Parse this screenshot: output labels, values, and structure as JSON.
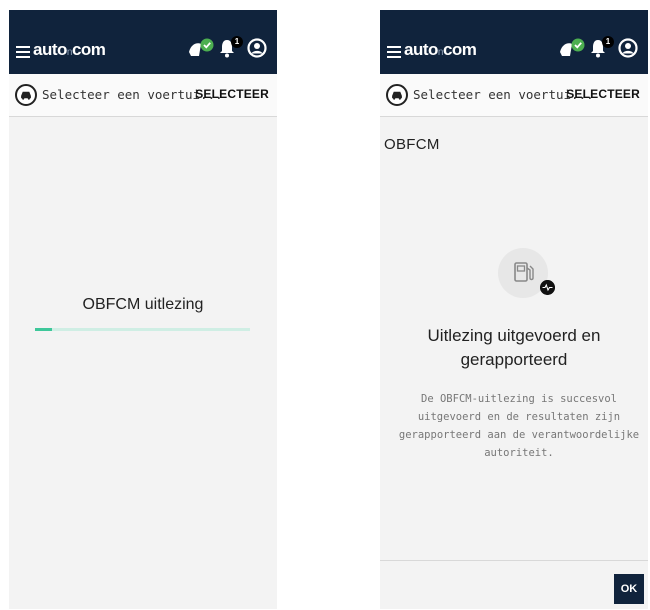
{
  "header": {
    "brand": {
      "left": "auto",
      "mid": "n",
      "right": "com"
    },
    "notification_count": "1"
  },
  "vehicle_bar": {
    "text": "Selecteer een voertui...",
    "select_label": "SELECTEER"
  },
  "left_screen": {
    "loading_title": "OBFCM uitlezing",
    "progress": 0.08
  },
  "right_screen": {
    "section_title": "OBFCM",
    "result_title_line1": "Uitlezing uitgevoerd en",
    "result_title_line2": "gerapporteerd",
    "description_lines": [
      "De OBFCM-uitlezing is succesvol",
      "uitgevoerd en de resultaten zijn",
      "gerapporteerd aan de verantwoordelijke",
      "autoriteit."
    ],
    "ok_label": "OK"
  },
  "colors": {
    "header_bg": "#10233c",
    "accent_green": "#3ec79a",
    "check_green": "#4caf50"
  },
  "icons": [
    "menu-icon",
    "vehicle-check-icon",
    "bell-icon",
    "account-icon",
    "car-icon",
    "fuel-pump-icon",
    "activity-icon"
  ]
}
